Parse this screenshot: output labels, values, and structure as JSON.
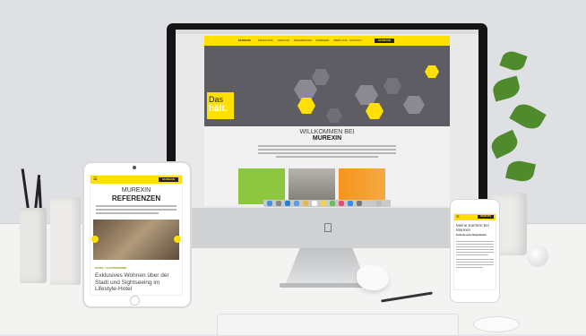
{
  "imac": {
    "nav_items": [
      "MUREXIN",
      "PRODUKTE",
      "SERVICE",
      "REFERENZEN",
      "KARRIERE",
      "ÜBER UNS",
      "KONTAKT"
    ],
    "logo": "MUREXIN",
    "hero_line1": "Das",
    "hero_line2": "hält.",
    "welcome_line1": "WILLKOMMEN BEI",
    "welcome_line2": "MUREXIN"
  },
  "ipad": {
    "logo": "MUREXIN",
    "heading_line1": "MUREXIN",
    "heading_line2": "REFERENZEN",
    "label": "HOTEL / GASTRONOMIE",
    "title": "Exklusives Wohnen über der Stadt und Sightseeing im Lifestyle-Hotel"
  },
  "iphone": {
    "logo": "MUREXIN",
    "title": "Meine Karriere bei Murexin",
    "subtitle": "Entdecke deine Möglichkeiten"
  },
  "colors": {
    "brand_yellow": "#ffe000",
    "brand_dark": "#222222",
    "hero_gray": "#5d5d63"
  }
}
